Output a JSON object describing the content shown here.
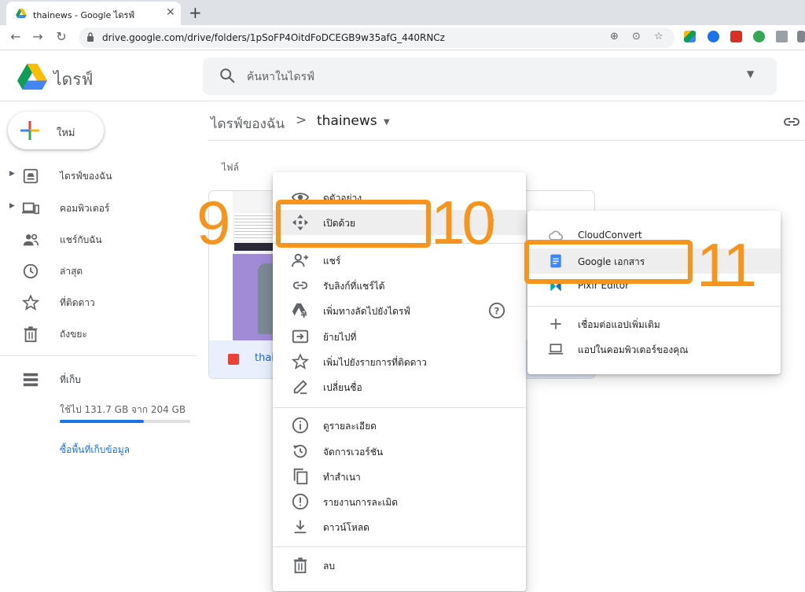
{
  "browser": {
    "tab_title": "thainews - Google ไดรฟ์",
    "tab_close": "✕",
    "new_tab": "+",
    "back": "←",
    "forward": "→",
    "reload": "↻",
    "url": "drive.google.com/drive/folders/1pSoFP4OitdFoDCEGB9w35afG_440RNCz"
  },
  "header": {
    "product_name": "ไดรฟ์",
    "search_placeholder": "ค้นหาในไดรฟ์",
    "search_options_caret": "▼"
  },
  "sidebar": {
    "new_label": "ใหม่",
    "items": [
      {
        "label": "ไดรฟ์ของฉัน",
        "icon": "my-drive-icon",
        "expandable": true
      },
      {
        "label": "คอมพิวเตอร์",
        "icon": "computers-icon",
        "expandable": true
      },
      {
        "label": "แชร์กับฉัน",
        "icon": "shared-icon",
        "expandable": false
      },
      {
        "label": "ล่าสุด",
        "icon": "recent-icon",
        "expandable": false
      },
      {
        "label": "ที่ติดดาว",
        "icon": "star-icon",
        "expandable": false
      },
      {
        "label": "ถังขยะ",
        "icon": "trash-icon",
        "expandable": false
      }
    ],
    "storage_label": "ที่เก็บ",
    "storage_text": "ใช้ไป 131.7 GB จาก 204 GB",
    "storage_used_fraction": 0.646,
    "buy_storage": "ซื้อพื้นที่เก็บข้อมูล"
  },
  "main": {
    "breadcrumb_root": "ไดรฟ์ของฉัน",
    "breadcrumb_sep": ">",
    "breadcrumb_current": "thainews",
    "breadcrumb_caret": "▼",
    "section_label": "ไฟล์",
    "file_name_partial": "thai"
  },
  "context_menu": {
    "items": [
      {
        "label": "ดูตัวอย่าง",
        "icon": "eye-icon"
      },
      {
        "label": "เปิดด้วย",
        "icon": "open-with-icon",
        "submenu": "›"
      },
      {
        "label": "แชร์",
        "icon": "share-person-icon"
      },
      {
        "label": "รับลิงก์ที่แชร์ได้",
        "icon": "link-icon"
      },
      {
        "label": "เพิ่มทางลัดไปยังไดรฟ์",
        "icon": "add-shortcut-icon",
        "help": "?"
      },
      {
        "label": "ย้ายไปที่",
        "icon": "move-to-icon"
      },
      {
        "label": "เพิ่มไปยังรายการที่ติดดาว",
        "icon": "star-outline-icon"
      },
      {
        "label": "เปลี่ยนชื่อ",
        "icon": "rename-icon"
      },
      {
        "label": "ดูรายละเอียด",
        "icon": "info-icon"
      },
      {
        "label": "จัดการเวอร์ชัน",
        "icon": "version-history-icon"
      },
      {
        "label": "ทำสำเนา",
        "icon": "copy-icon"
      },
      {
        "label": "รายงานการละเมิด",
        "icon": "report-icon"
      },
      {
        "label": "ดาวน์โหลด",
        "icon": "download-icon"
      },
      {
        "label": "ลบ",
        "icon": "trash-icon"
      }
    ]
  },
  "open_with_menu": {
    "items": [
      {
        "label": "CloudConvert",
        "icon": "cloudconvert-icon"
      },
      {
        "label": "Google เอกสาร",
        "icon": "google-docs-icon"
      },
      {
        "label": "Pixlr Editor",
        "icon": "pixlr-icon"
      },
      {
        "label": "เชื่อมต่อแอปเพิ่มเติม",
        "icon": "plus-icon"
      },
      {
        "label": "แอปในคอมพิวเตอร์ของคุณ",
        "icon": "laptop-icon"
      }
    ]
  },
  "annotations": {
    "step_9": "9",
    "step_10": "10",
    "step_11": "11"
  },
  "colors": {
    "accent_orange": "#f7941d",
    "drive_blue": "#1a73e8",
    "menu_hover": "#eeeeee"
  }
}
